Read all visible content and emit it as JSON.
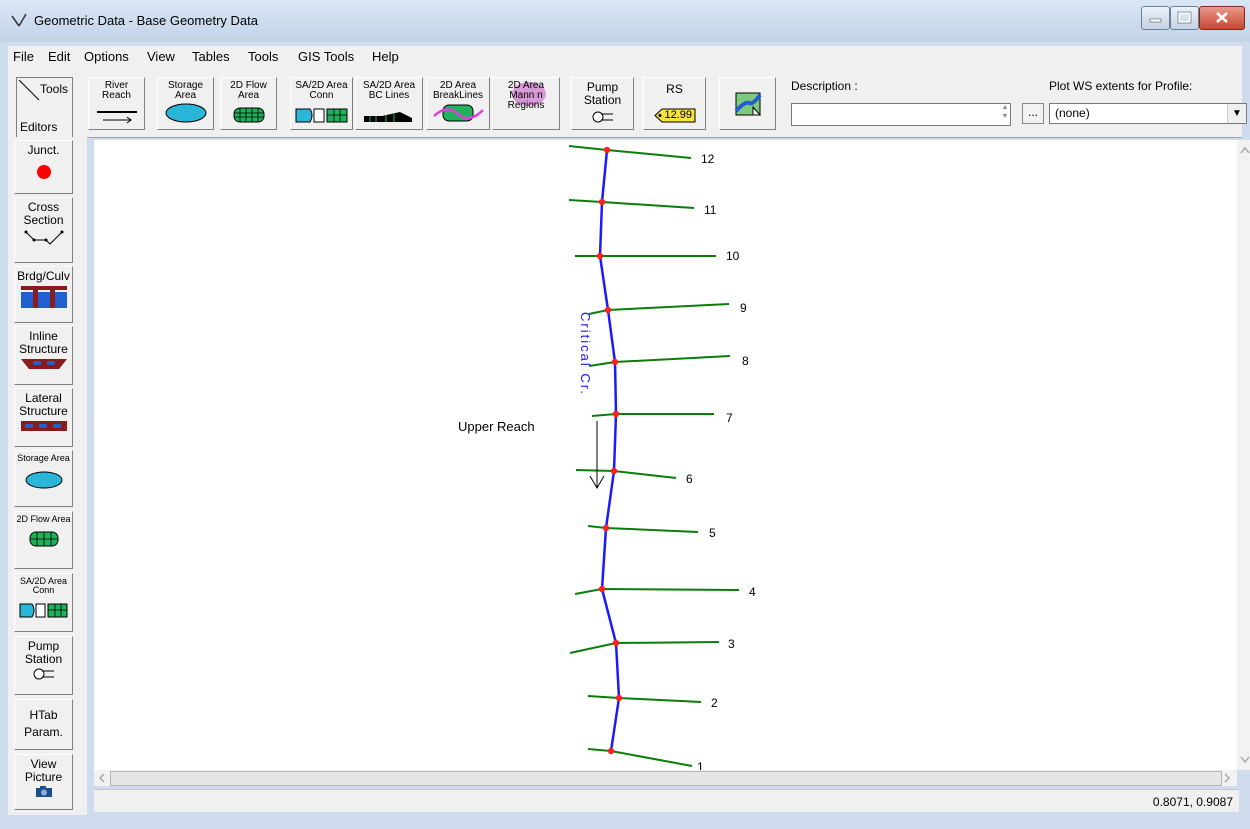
{
  "window": {
    "title": "Geometric Data - Base Geometry Data"
  },
  "menu": [
    "File",
    "Edit",
    "Options",
    "View",
    "Tables",
    "Tools",
    "GIS Tools",
    "Help"
  ],
  "toolbar": {
    "tools_label": "Tools",
    "editors_label": "Editors",
    "river_reach": "River Reach",
    "storage_area": "Storage Area",
    "flow_area_2d": "2D Flow Area",
    "sa2d_conn": "SA/2D Area Conn",
    "sa2d_bc": "SA/2D Area BC Lines",
    "breaklines": "2D Area BreakLines",
    "mann_regions": "2D Area Mann n Regions",
    "pump_station": "Pump Station",
    "rs": "RS",
    "rs_value": "12.99",
    "description_label": "Description :",
    "description_value": "",
    "ellipsis": "...",
    "plot_ws_label": "Plot WS extents for Profile:",
    "plot_ws_value": "(none)"
  },
  "sidebar": {
    "junct": "Junct.",
    "cross_section": "Cross Section",
    "brdg_culv": "Brdg/Culv",
    "inline_structure": "Inline Structure",
    "lateral_structure": "Lateral Structure",
    "storage_area": "Storage Area",
    "flow_area_2d": "2D Flow Area",
    "sa2d_conn": "SA/2D Area Conn",
    "pump_station": "Pump Station",
    "htab": "HTab Param.",
    "view_picture": "View Picture"
  },
  "schematic": {
    "river_name": "Critical Cr.",
    "reach_name": "Upper Reach",
    "cross_sections": [
      "12",
      "11",
      "10",
      "9",
      "8",
      "7",
      "6",
      "5",
      "4",
      "3",
      "2",
      "1"
    ],
    "colors": {
      "river": "#1a1aff",
      "xs": "#0a7d0a",
      "node": "#ff2020"
    }
  },
  "status": {
    "coords": "0.8071, 0.9087"
  }
}
